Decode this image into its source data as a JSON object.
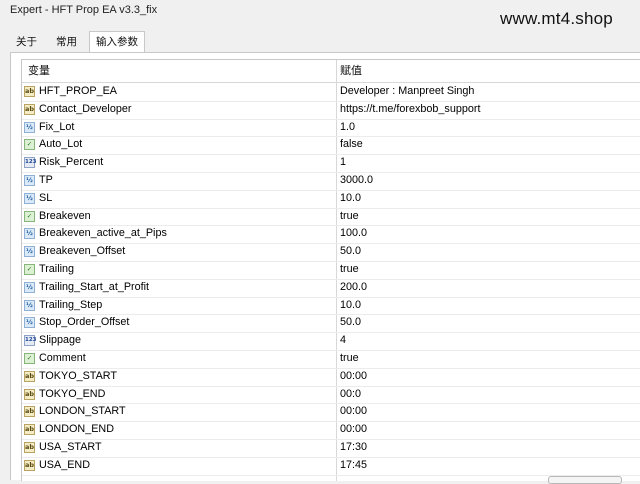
{
  "window": {
    "title": "Expert - HFT Prop EA v3.3_fix",
    "watermark": "www.mt4.shop"
  },
  "tabs": [
    {
      "label": "关于",
      "active": false
    },
    {
      "label": "常用",
      "active": false
    },
    {
      "label": "输入参数",
      "active": true
    }
  ],
  "table": {
    "headers": {
      "variable": "变量",
      "value": "赋值"
    },
    "rows": [
      {
        "icon": "ab",
        "name": "HFT_PROP_EA",
        "value": "Developer : Manpreet Singh"
      },
      {
        "icon": "ab",
        "name": "Contact_Developer",
        "value": "https://t.me/forexbob_support"
      },
      {
        "icon": "half",
        "name": "Fix_Lot",
        "value": "1.0"
      },
      {
        "icon": "bool",
        "name": "Auto_Lot",
        "value": "false"
      },
      {
        "icon": "n123",
        "name": "Risk_Percent",
        "value": "1"
      },
      {
        "icon": "half",
        "name": "TP",
        "value": "3000.0"
      },
      {
        "icon": "half",
        "name": "SL",
        "value": "10.0"
      },
      {
        "icon": "bool",
        "name": "Breakeven",
        "value": "true"
      },
      {
        "icon": "half",
        "name": "Breakeven_active_at_Pips",
        "value": "100.0"
      },
      {
        "icon": "half",
        "name": "Breakeven_Offset",
        "value": "50.0"
      },
      {
        "icon": "bool",
        "name": "Trailing",
        "value": "true"
      },
      {
        "icon": "half",
        "name": "Trailing_Start_at_Profit",
        "value": "200.0"
      },
      {
        "icon": "half",
        "name": "Trailing_Step",
        "value": "10.0"
      },
      {
        "icon": "half",
        "name": "Stop_Order_Offset",
        "value": "50.0"
      },
      {
        "icon": "n123",
        "name": "Slippage",
        "value": "4"
      },
      {
        "icon": "bool",
        "name": "Comment",
        "value": "true"
      },
      {
        "icon": "ab",
        "name": "TOKYO_START",
        "value": "00:00"
      },
      {
        "icon": "ab",
        "name": "TOKYO_END",
        "value": "00:0"
      },
      {
        "icon": "ab",
        "name": "LONDON_START",
        "value": "00:00"
      },
      {
        "icon": "ab",
        "name": "LONDON_END",
        "value": "00:00"
      },
      {
        "icon": "ab",
        "name": "USA_START",
        "value": "17:30"
      },
      {
        "icon": "ab",
        "name": "USA_END",
        "value": "17:45"
      }
    ]
  },
  "icon_glyphs": {
    "ab": "ab",
    "half": "½",
    "bool": "✓",
    "n123": "123"
  }
}
